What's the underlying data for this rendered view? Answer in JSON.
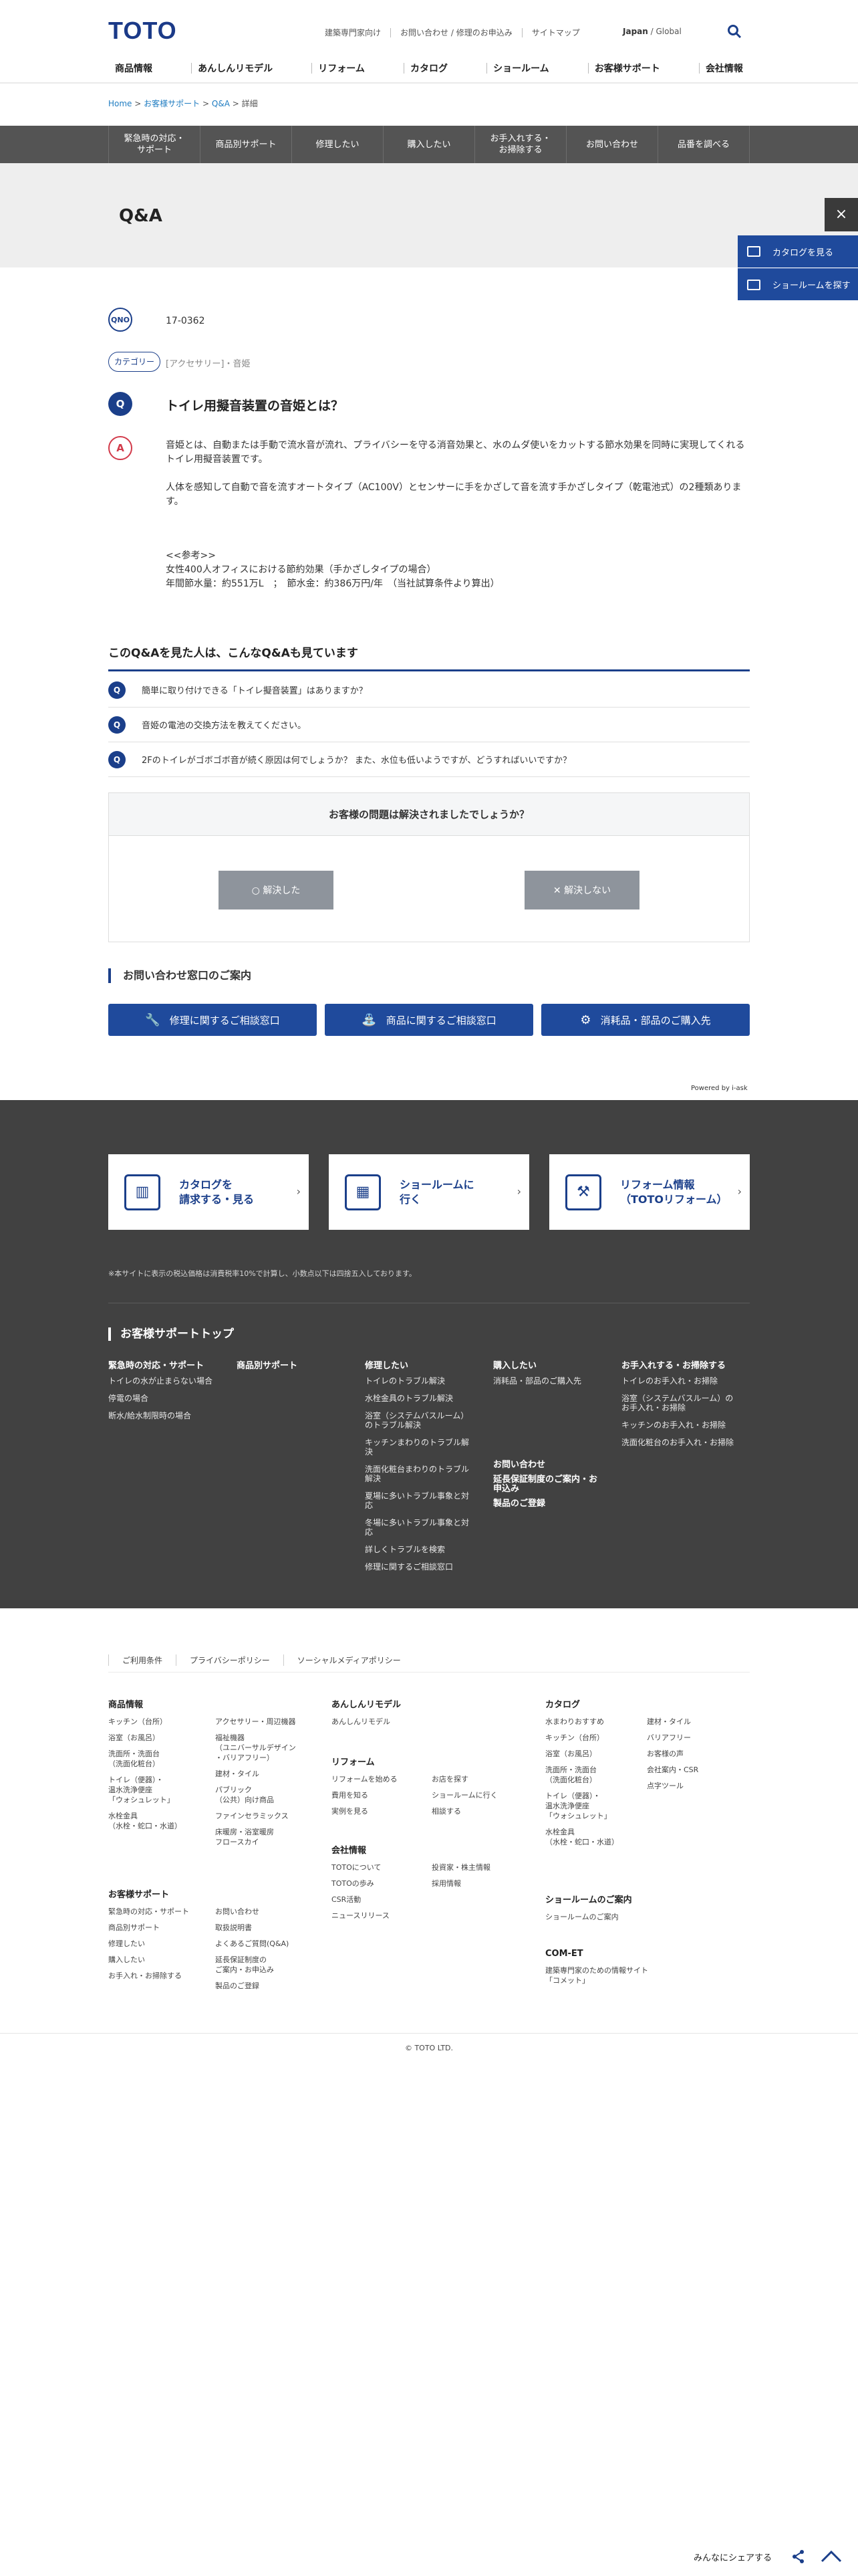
{
  "header": {
    "logo": "TOTO",
    "links": [
      "建築専門家向け",
      "お問い合わせ / 修理のお申込み",
      "サイトマップ"
    ],
    "lang_current": "Japan",
    "lang_sep": "/",
    "lang_other": "Global",
    "nav": [
      "商品情報",
      "あんしんリモデル",
      "リフォーム",
      "カタログ",
      "ショールーム",
      "お客様サポート",
      "会社情報"
    ]
  },
  "breadcrumb": {
    "items": [
      "Home",
      "お客様サポート",
      "Q&A"
    ],
    "current": "詳細",
    "sep": ">"
  },
  "category_bar": [
    "緊急時の対応・\nサポート",
    "商品別サポート",
    "修理したい",
    "購入したい",
    "お手入れする・\nお掃除する",
    "お問い合わせ",
    "品番を調べる"
  ],
  "page_title": "Q&A",
  "side": {
    "close": "×",
    "catalog": "カタログを見る",
    "showroom": "ショールームを探す"
  },
  "qa": {
    "no_label": "QNO",
    "no": "17-0362",
    "category_label": "カテゴリー",
    "category": "[アクセサリー]・音姫",
    "q_label": "Q",
    "question": "トイレ用擬音装置の音姫とは？",
    "a_label": "A",
    "answer_p1": "音姫とは、自動または手動で流水音が流れ、プライバシーを守る消音効果と、水のムダ使いをカットする節水効果を同時に実現してくれるトイレ用擬音装置です。",
    "answer_p2": "人体を感知して自動で音を流すオートタイプ（AC100V）とセンサーに手をかざして音を流す手かざしタイプ（乾電池式）の2種類あります。",
    "ref_title": "<<参考>>",
    "ref_line1": "女性400人オフィスにおける節約効果（手かざしタイプの場合）",
    "ref_line2": "年間節水量：約551万L　；　節水金：約386万円/年　（当社試算条件より算出）"
  },
  "related": {
    "heading": "このQ&Aを見た人は、こんなQ&Aも見ています",
    "items": [
      "簡単に取り付けできる「トイレ擬音装置」はありますか？",
      "音姫の電池の交換方法を教えてください。",
      "2Fのトイレがゴボゴボ音が続く原因は何でしょうか？ また、水位も低いようですが、どうすればいいですか？"
    ]
  },
  "survey": {
    "question": "お客様の問題は解決されましたでしょうか？",
    "yes": "○ 解決した",
    "no": "✕ 解決しない"
  },
  "contact": {
    "heading": "お問い合わせ窓口のご案内",
    "buttons": [
      "修理に関するご相談窓口",
      "商品に関するご相談窓口",
      "消耗品・部品のご購入先"
    ]
  },
  "powered": "Powered by i-ask",
  "footer_cards": [
    {
      "icon": "catalog-icon",
      "text": "カタログを\n請求する・見る"
    },
    {
      "icon": "showroom-icon",
      "text": "ショールームに\n行く"
    },
    {
      "icon": "tools-icon",
      "text": "リフォーム情報\n（TOTOリフォーム）"
    }
  ],
  "tax_note": "※本サイトに表示の税込価格は消費税率10%で計算し、小数点以下は四捨五入しております。",
  "support_top": {
    "heading": "お客様サポートトップ",
    "cols": [
      {
        "title": "緊急時の対応・サポート",
        "links": [
          "トイレの水が止まらない場合",
          "停電の場合",
          "断水/給水制限時の場合"
        ]
      },
      {
        "title": "商品別サポート",
        "links": []
      },
      {
        "title": "修理したい",
        "links": [
          "トイレのトラブル解決",
          "水栓金具のトラブル解決",
          "浴室（システムバスルーム）のトラブル解決",
          "キッチンまわりのトラブル解決",
          "洗面化粧台まわりのトラブル解決",
          "夏場に多いトラブル事象と対応",
          "冬場に多いトラブル事象と対応",
          "詳しくトラブルを検索",
          "修理に関するご相談窓口"
        ]
      },
      {
        "title": "購入したい",
        "links": [
          "消耗品・部品のご購入先"
        ],
        "extra": [
          "お問い合わせ",
          "延長保証制度のご案内・お申込み",
          "製品のご登録"
        ]
      },
      {
        "title": "お手入れする・お掃除する",
        "links": [
          "トイレのお手入れ・お掃除",
          "浴室（システムバスルーム）のお手入れ・お掃除",
          "キッチンのお手入れ・お掃除",
          "洗面化粧台のお手入れ・お掃除"
        ]
      }
    ]
  },
  "footer_links": [
    "ご利用条件",
    "プライバシーポリシー",
    "ソーシャルメディアポリシー"
  ],
  "sitemap": {
    "products": {
      "title": "商品情報",
      "a": [
        "キッチン（台所）",
        "浴室（お風呂）",
        "洗面所・洗面台\n（洗面化粧台）",
        "トイレ（便器）・\n温水洗浄便座\n「ウォシュレット」",
        "水栓金具\n（水栓・蛇口・水道）"
      ],
      "b": [
        "アクセサリー・周辺機器",
        "福祉機器\n（ユニバーサルデザイン\n・バリアフリー）",
        "建材・タイル",
        "パブリック\n（公共）向け商品",
        "ファインセラミックス",
        "床暖房・浴室暖房\nフロースカイ"
      ]
    },
    "remodel": {
      "title": "あんしんリモデル",
      "links": [
        "あんしんリモデル"
      ]
    },
    "reform": {
      "title": "リフォーム",
      "a": [
        "リフォームを始める",
        "費用を知る",
        "実例を見る"
      ],
      "b": [
        "お店を探す",
        "ショールームに行く",
        "相談する"
      ]
    },
    "company": {
      "title": "会社情報",
      "a": [
        "TOTOについて",
        "TOTOの歩み",
        "CSR活動",
        "ニュースリリース"
      ],
      "b": [
        "投資家・株主情報",
        "採用情報"
      ]
    },
    "catalog": {
      "title": "カタログ",
      "a": [
        "水まわりおすすめ",
        "キッチン（台所）",
        "浴室（お風呂）",
        "洗面所・洗面台\n（洗面化粧台）",
        "トイレ（便器）・\n温水洗浄便座\n「ウォシュレット」",
        "水栓金具\n（水栓・蛇口・水道）"
      ],
      "b": [
        "建材・タイル",
        "バリアフリー",
        "お客様の声",
        "会社案内・CSR",
        "点字ツール"
      ]
    },
    "support": {
      "title": "お客様サポート",
      "a": [
        "緊急時の対応・サポート",
        "商品別サポート",
        "修理したい",
        "購入したい",
        "お手入れ・お掃除する"
      ],
      "b": [
        "お問い合わせ",
        "取扱説明書",
        "よくあるご質問(Q&A)",
        "延長保証制度の\nご案内・お申込み",
        "製品のご登録"
      ]
    },
    "showroom": {
      "title": "ショールームのご案内",
      "links": [
        "ショールームのご案内"
      ]
    },
    "comet": {
      "title": "COM-ET",
      "links": [
        "建築専門家のための情報サイト「コメット」"
      ]
    }
  },
  "copyright": "© TOTO LTD.",
  "share": "みんなにシェアする"
}
